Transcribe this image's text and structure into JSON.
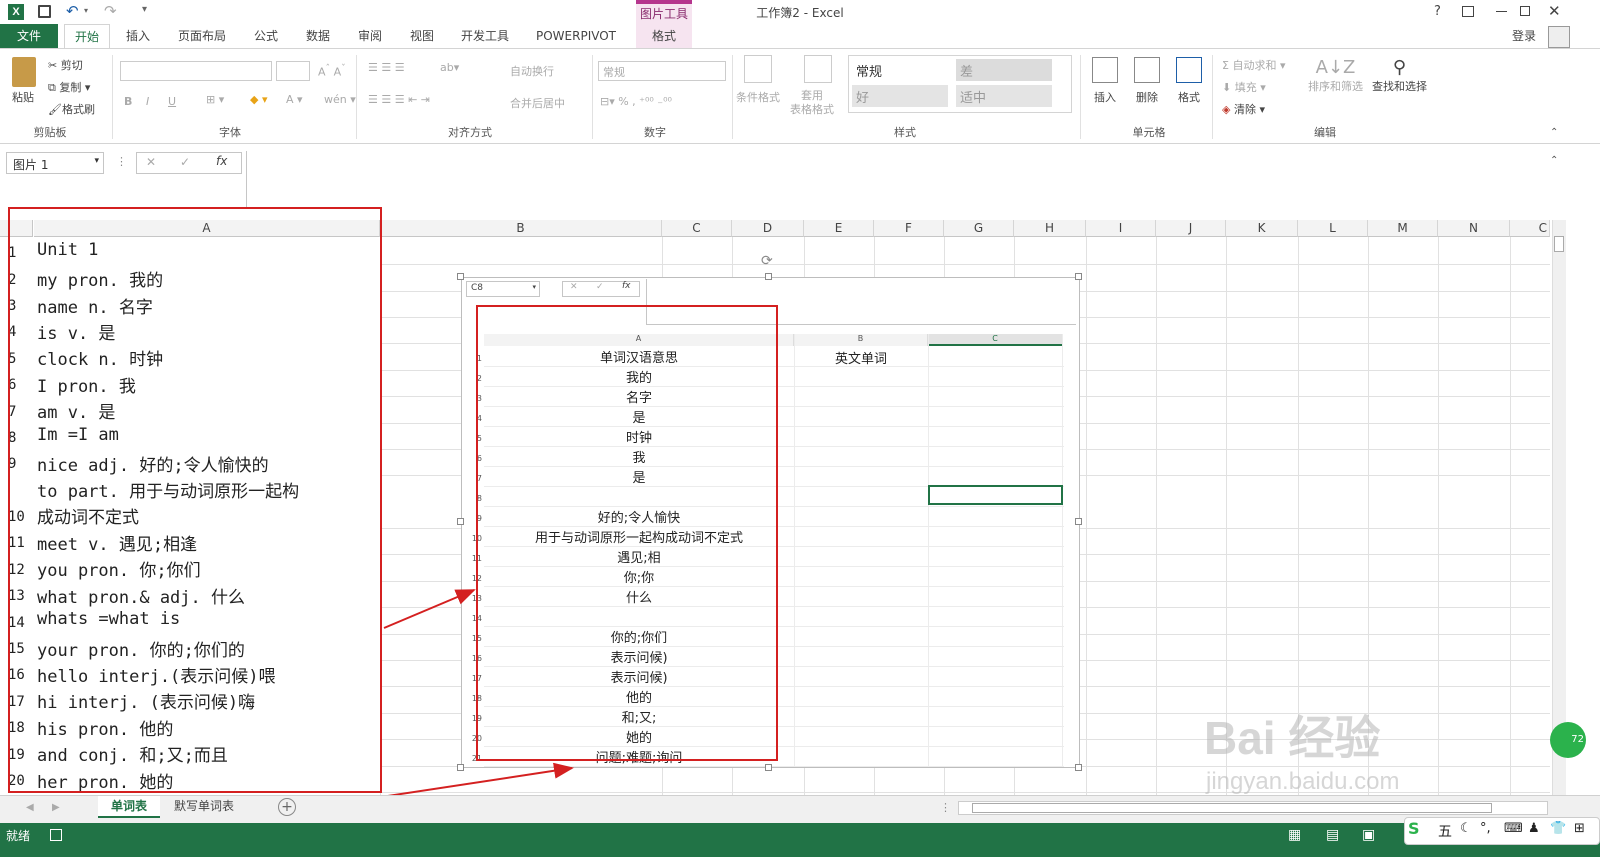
{
  "title": {
    "window_title": "工作簿2 - Excel",
    "context_group": "图片工具",
    "login": "登录"
  },
  "tabs": {
    "file": "文件",
    "home": "开始",
    "insert": "插入",
    "layout": "页面布局",
    "formulas": "公式",
    "data": "数据",
    "review": "审阅",
    "view": "视图",
    "developer": "开发工具",
    "powerpivot": "POWERPIVOT",
    "format": "格式"
  },
  "ribbon": {
    "clipboard": {
      "paste": "粘贴",
      "cut": "剪切",
      "copy": "复制",
      "format_painter": "格式刷",
      "label": "剪贴板"
    },
    "font": {
      "label": "字体",
      "bold": "B",
      "italic": "I",
      "underline": "U"
    },
    "alignment": {
      "wrap": "自动换行",
      "merge": "合并后居中",
      "label": "对齐方式"
    },
    "number": {
      "format": "常规",
      "label": "数字"
    },
    "styles": {
      "conditional": "条件格式",
      "table": "套用\n表格格式",
      "normal": "常规",
      "bad": "差",
      "good": "好",
      "neutral": "适中",
      "label": "样式"
    },
    "cells": {
      "insert": "插入",
      "delete": "删除",
      "format": "格式",
      "label": "单元格"
    },
    "editing": {
      "autosum": "自动求和",
      "fill": "填充",
      "clear": "清除",
      "sort": "排序和筛选",
      "find": "查找和选择",
      "label": "编辑"
    }
  },
  "formula_bar": {
    "name_box": "图片 1",
    "fx": "fx"
  },
  "columns": [
    "A",
    "B",
    "C",
    "D",
    "E",
    "F",
    "G",
    "H",
    "I",
    "J",
    "K",
    "L",
    "M",
    "N",
    "C"
  ],
  "rows": [
    {
      "n": "1",
      "a": "Unit 1"
    },
    {
      "n": "2",
      "a": "my pron. 我的"
    },
    {
      "n": "3",
      "a": "name n. 名字"
    },
    {
      "n": "4",
      "a": "is v. 是"
    },
    {
      "n": "5",
      "a": "clock n. 时钟"
    },
    {
      "n": "6",
      "a": "I pron. 我"
    },
    {
      "n": "7",
      "a": "am v. 是"
    },
    {
      "n": "8",
      "a": "Im =I am"
    },
    {
      "n": "9",
      "a": "nice adj. 好的;令人愉快的"
    },
    {
      "n": "10",
      "a": "to part. 用于与动词原形一起构",
      "a2": "成动词不定式"
    },
    {
      "n": "11",
      "a": "meet v. 遇见;相逢"
    },
    {
      "n": "12",
      "a": "you pron. 你;你们"
    },
    {
      "n": "13",
      "a": "what pron.& adj. 什么"
    },
    {
      "n": "14",
      "a": "whats =what is"
    },
    {
      "n": "15",
      "a": "your pron. 你的;你们的"
    },
    {
      "n": "16",
      "a": "hello interj.(表示问候)喂"
    },
    {
      "n": "17",
      "a": "hi interj. (表示问候)嗨"
    },
    {
      "n": "18",
      "a": "his pron. 他的"
    },
    {
      "n": "19",
      "a": "and conj. 和;又;而且"
    },
    {
      "n": "20",
      "a": "her pron. 她的"
    }
  ],
  "embedded": {
    "name_box": "C8",
    "fx": "fx",
    "columns": [
      "A",
      "B",
      "C"
    ],
    "header_b": "英文单词",
    "rows": [
      "单词汉语意思",
      "我的",
      "名字",
      "是",
      "时钟",
      "我",
      "是",
      "",
      "好的;令人愉快",
      "用于与动词原形一起构成动词不定式",
      "遇见;相",
      "你;你",
      "什么",
      "",
      "你的;你们",
      "表示问候)",
      "表示问候)",
      "他的",
      "和;又;",
      "她的",
      "问题;难题;询问"
    ]
  },
  "sheets": [
    "单词表",
    "默写单词表"
  ],
  "status": {
    "ready": "就绪",
    "ime": "五"
  },
  "watermark": "Bai 经验",
  "watermark_url": "jingyan.baidu.com",
  "badge": "72"
}
